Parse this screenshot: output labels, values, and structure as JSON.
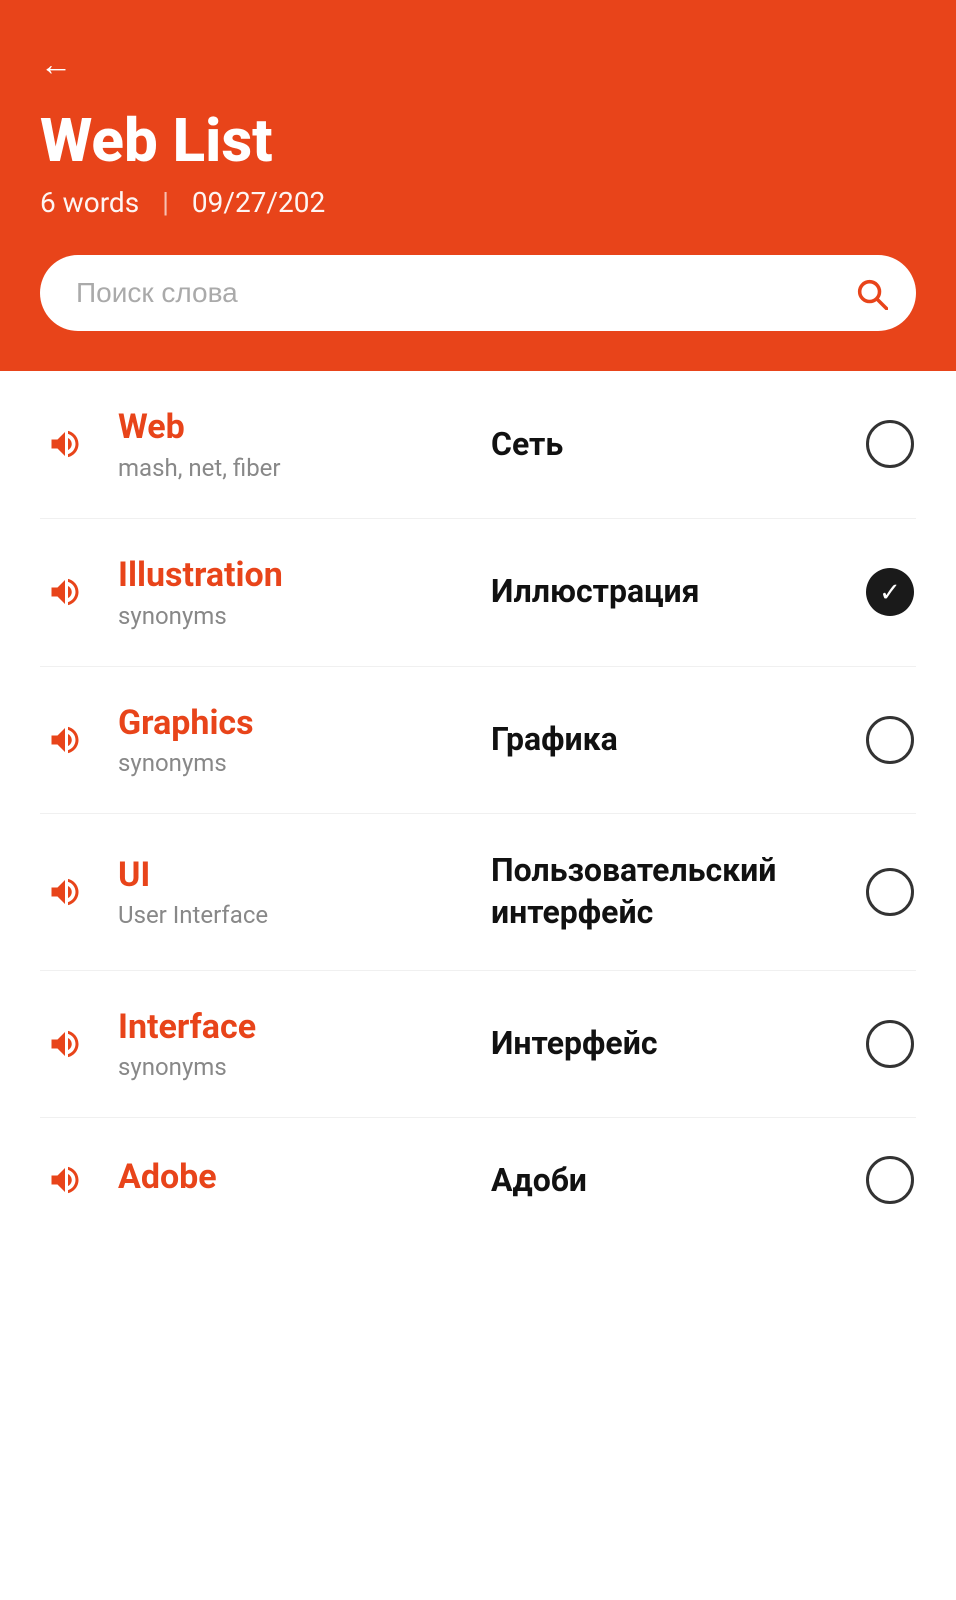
{
  "header": {
    "back_label": "←",
    "title": "Web List",
    "word_count": "6 words",
    "date": "09/27/202",
    "search_placeholder": "Поиск слова"
  },
  "words": [
    {
      "id": "web",
      "english": "Web",
      "hint": "mash, net, fiber",
      "translation": "Сеть",
      "checked": false
    },
    {
      "id": "illustration",
      "english": "Illustration",
      "hint": "synonyms",
      "translation": "Иллюстрация",
      "checked": true
    },
    {
      "id": "graphics",
      "english": "Graphics",
      "hint": "synonyms",
      "translation": "Графика",
      "checked": false
    },
    {
      "id": "ui",
      "english": "UI",
      "hint": "User Interface",
      "translation": "Пользовательский интерфейс",
      "checked": false
    },
    {
      "id": "interface",
      "english": "Interface",
      "hint": "synonyms",
      "translation": "Интерфейс",
      "checked": false
    },
    {
      "id": "adobe",
      "english": "Adobe",
      "hint": "",
      "translation": "Адоби",
      "checked": false
    }
  ]
}
